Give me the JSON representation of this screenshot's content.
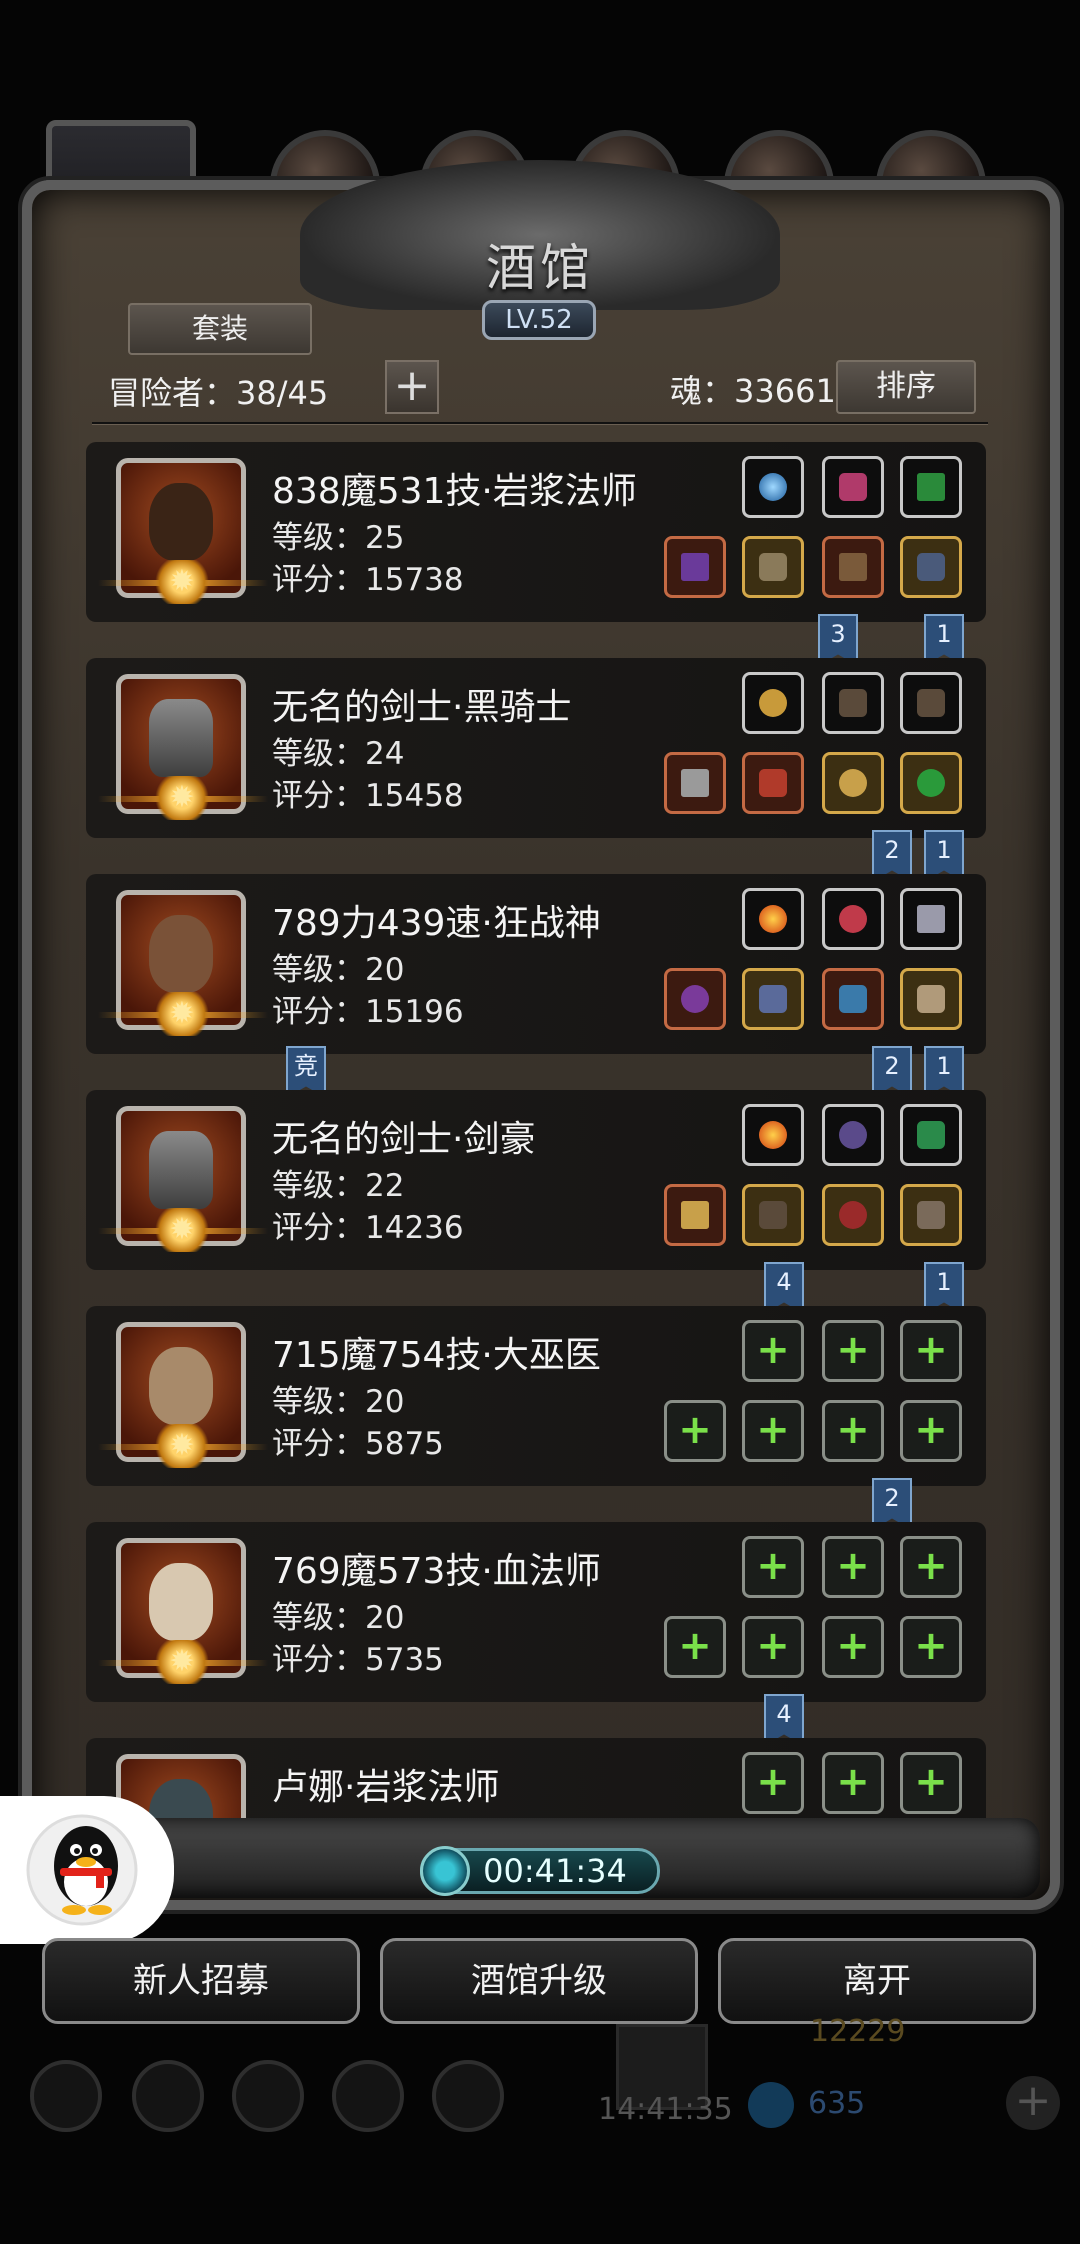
{
  "header": {
    "title": "酒馆",
    "level": "LV.52",
    "suit_button": "套装",
    "adventurers": "冒险者：38/45",
    "add_button": "+",
    "soul": "魂：33661",
    "sort_button": "排序"
  },
  "heroes": [
    {
      "name": "838魔531技·岩浆法师",
      "level": "等级：25",
      "score": "评分：15738",
      "portrait": "dark-skinned-mage",
      "tags": [
        "3",
        "1"
      ]
    },
    {
      "name": "无名的剑士·黑骑士",
      "level": "等级：24",
      "score": "评分：15458",
      "portrait": "helmet-knight",
      "tags": [
        "2",
        "1"
      ]
    },
    {
      "name": "789力439速·狂战神",
      "level": "等级：20",
      "score": "评分：15196",
      "portrait": "berserker",
      "tags": [
        "竞",
        "2",
        "1"
      ]
    },
    {
      "name": "无名的剑士·剑豪",
      "level": "等级：22",
      "score": "评分：14236",
      "portrait": "helmet-swordsman",
      "tags": [
        "4",
        "1"
      ]
    },
    {
      "name": "715魔754技·大巫医",
      "level": "等级：20",
      "score": "评分：5875",
      "portrait": "elder-shaman",
      "tags": [
        "2"
      ]
    },
    {
      "name": "769魔573技·血法师",
      "level": "等级：20",
      "score": "评分：5735",
      "portrait": "elf-mage",
      "tags": [
        "4"
      ]
    },
    {
      "name": "卢娜·岩浆法师",
      "level": "",
      "score": "",
      "portrait": "hooded-mage",
      "tags": []
    }
  ],
  "timer": "00:41:34",
  "bottom_buttons": {
    "recruit": "新人招募",
    "upgrade": "酒馆升级",
    "leave": "离开"
  },
  "background_hud": {
    "clock": "14:41:35",
    "gold": "12229",
    "gems": "635"
  },
  "colors": {
    "accent_gold": "#d4a84a",
    "plus_green": "#7ae04a",
    "tag_blue": "#2c4e78"
  }
}
